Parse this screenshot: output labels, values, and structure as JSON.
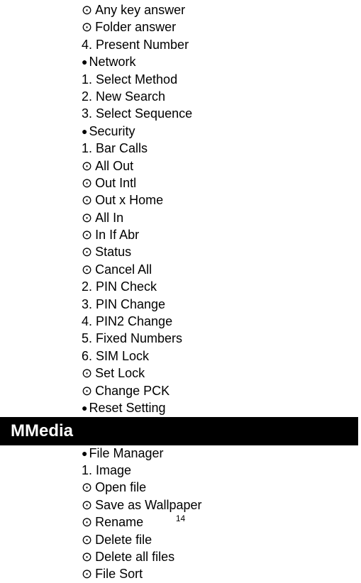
{
  "items": [
    {
      "type": "circle",
      "text": "Any key answer"
    },
    {
      "type": "circle",
      "text": "Folder answer"
    },
    {
      "type": "num",
      "text": "4. Present Number"
    },
    {
      "type": "filled",
      "text": "Network"
    },
    {
      "type": "num",
      "text": "1. Select Method"
    },
    {
      "type": "num",
      "text": "2. New Search"
    },
    {
      "type": "num",
      "text": "3. Select Sequence"
    },
    {
      "type": "filled",
      "text": "Security"
    },
    {
      "type": "num",
      "text": "1. Bar Calls"
    },
    {
      "type": "circle",
      "text": "All Out"
    },
    {
      "type": "circle",
      "text": "Out Intl"
    },
    {
      "type": "circle",
      "text": "Out x Home"
    },
    {
      "type": "circle",
      "text": "All In"
    },
    {
      "type": "circle",
      "text": "In If Abr"
    },
    {
      "type": "circle",
      "text": "Status"
    },
    {
      "type": "circle",
      "text": "Cancel All"
    },
    {
      "type": "num",
      "text": "2. PIN Check"
    },
    {
      "type": "num",
      "text": "3. PIN Change"
    },
    {
      "type": "num",
      "text": "4. PIN2 Change"
    },
    {
      "type": "num",
      "text": "5. Fixed Numbers"
    },
    {
      "type": "num",
      "text": "6. SIM Lock"
    },
    {
      "type": "circle",
      "text": "Set Lock"
    },
    {
      "type": "circle",
      "text": "Change PCK"
    },
    {
      "type": "filled",
      "text": "Reset Setting"
    }
  ],
  "section_header": "MMedia",
  "items2": [
    {
      "type": "filled",
      "text": "File Manager"
    },
    {
      "type": "num",
      "text": "1. Image"
    },
    {
      "type": "circle",
      "text": "Open file"
    },
    {
      "type": "circle",
      "text": "Save as Wallpaper"
    },
    {
      "type": "circle",
      "text": "Rename"
    },
    {
      "type": "circle",
      "text": "Delete file"
    },
    {
      "type": "circle",
      "text": "Delete all files"
    },
    {
      "type": "circle",
      "text": "File Sort"
    }
  ],
  "page_number": "14"
}
